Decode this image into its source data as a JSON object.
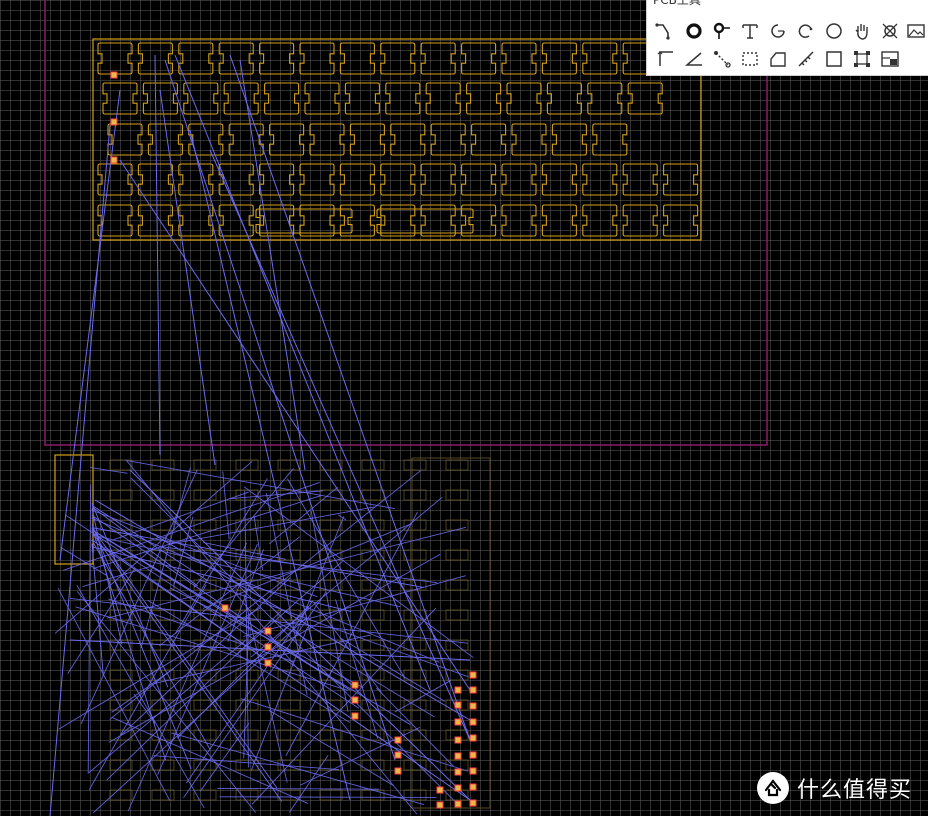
{
  "toolbar": {
    "title": "PCB工具",
    "tools_row1": [
      {
        "name": "track-tool",
        "icon": "track-icon"
      },
      {
        "name": "pad-tool",
        "icon": "pad-icon"
      },
      {
        "name": "via-tool",
        "icon": "via-icon"
      },
      {
        "name": "text-tool",
        "icon": "text-icon"
      },
      {
        "name": "arc-center-tool",
        "icon": "arc-center-icon"
      },
      {
        "name": "arc-tool",
        "icon": "arc-icon"
      },
      {
        "name": "circle-tool",
        "icon": "circle-icon"
      },
      {
        "name": "pan-tool",
        "icon": "hand-icon"
      },
      {
        "name": "hole-tool",
        "icon": "hole-icon"
      },
      {
        "name": "image-tool",
        "icon": "image-icon"
      }
    ],
    "tools_row2": [
      {
        "name": "dimension-tool",
        "icon": "dimension-icon"
      },
      {
        "name": "angle-tool",
        "icon": "angle-icon"
      },
      {
        "name": "connect-tool",
        "icon": "connect-icon"
      },
      {
        "name": "copper-area-tool",
        "icon": "copper-area-icon"
      },
      {
        "name": "solid-region-tool",
        "icon": "solid-region-icon"
      },
      {
        "name": "measure-tool",
        "icon": "measure-icon"
      },
      {
        "name": "rectangle-tool",
        "icon": "rectangle-icon"
      },
      {
        "name": "group-tool",
        "icon": "group-icon"
      },
      {
        "name": "canvas-settings-tool",
        "icon": "canvas-settings-icon"
      }
    ]
  },
  "colors": {
    "background": "#000000",
    "grid": "#5a5a5a",
    "board_outline": "#8b1a6b",
    "keycap_outline": "#d4a017",
    "ratsnest": "#6a6af0",
    "pad": "#e8b84a",
    "pad_highlight": "#ff4040"
  },
  "watermark": {
    "logo": "值",
    "text": "什么值得买"
  }
}
